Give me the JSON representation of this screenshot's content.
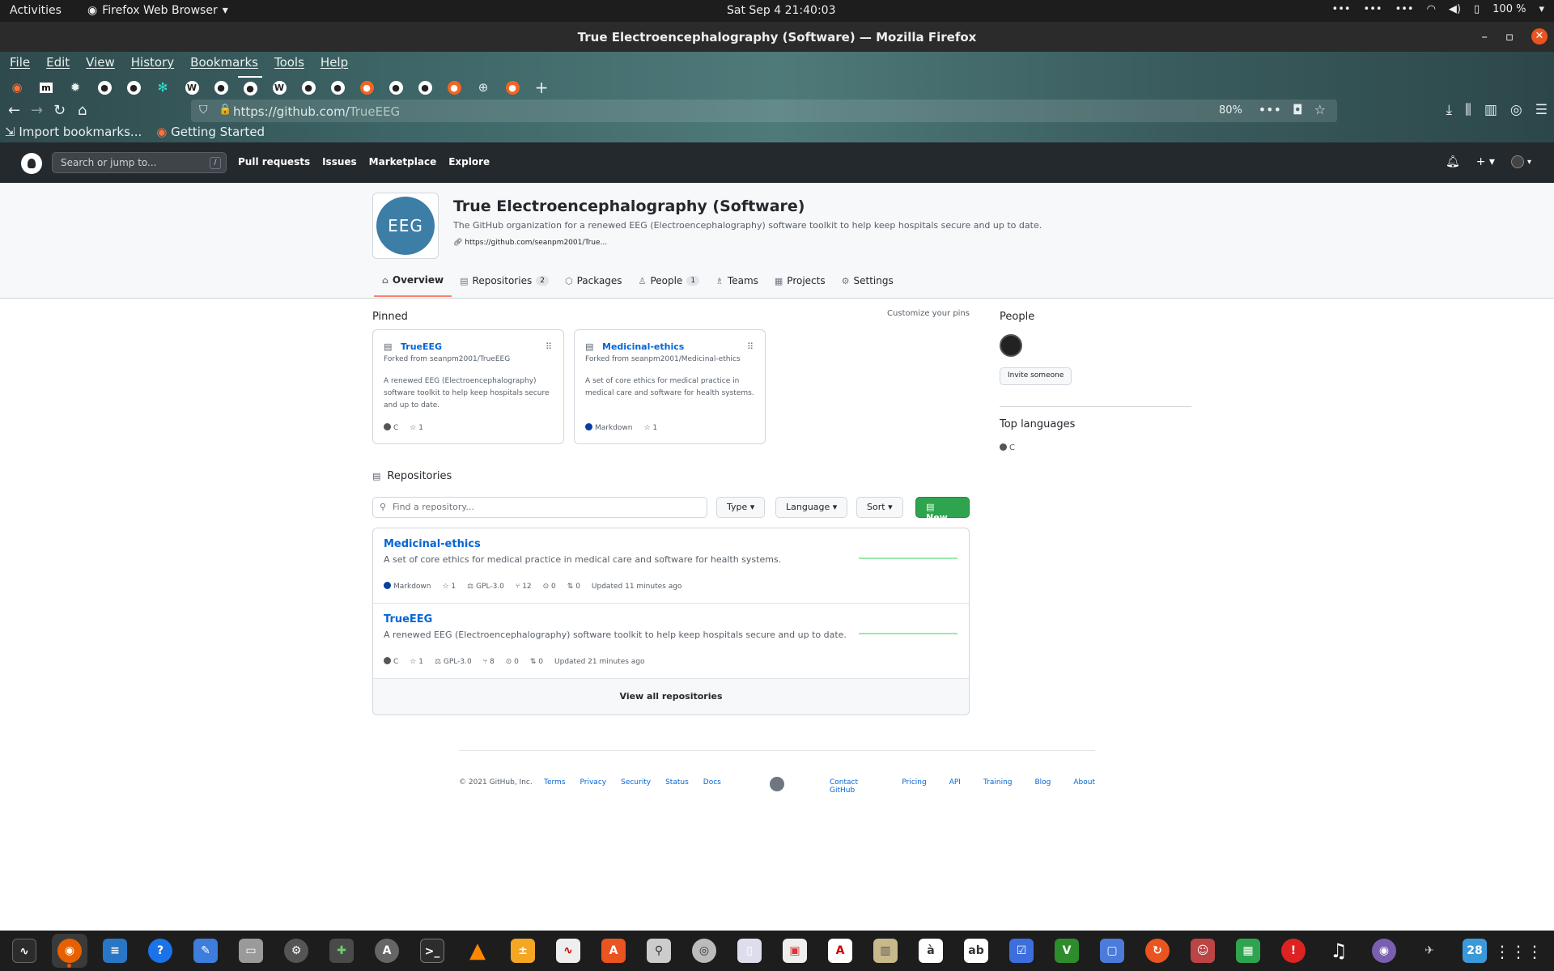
{
  "gnome": {
    "activities": "Activities",
    "app_menu": "Firefox Web Browser",
    "clock": "Sat Sep 4  21:40:03",
    "battery": "100 %"
  },
  "window": {
    "title": "True Electroencephalography (Software) — Mozilla Firefox"
  },
  "menubar": [
    "File",
    "Edit",
    "View",
    "History",
    "Bookmarks",
    "Tools",
    "Help"
  ],
  "browser": {
    "url_prefix": "https://github.com/",
    "url_path": "TrueEEG",
    "zoom": "80%",
    "bookmarks": [
      "Import bookmarks...",
      "Getting Started"
    ]
  },
  "github_header": {
    "search_placeholder": "Search or jump to...",
    "slash": "/",
    "nav": [
      "Pull requests",
      "Issues",
      "Marketplace",
      "Explore"
    ]
  },
  "org": {
    "avatar_text": "EEG",
    "name": "True Electroencephalography (Software)",
    "description": "The GitHub organization for a renewed EEG (Electroencephalography) software toolkit to help keep hospitals secure and up to date.",
    "link": "https://github.com/seanpm2001/True...",
    "tabs": [
      {
        "label": "Overview",
        "count": ""
      },
      {
        "label": "Repositories",
        "count": "2"
      },
      {
        "label": "Packages",
        "count": ""
      },
      {
        "label": "People",
        "count": "1"
      },
      {
        "label": "Teams",
        "count": ""
      },
      {
        "label": "Projects",
        "count": ""
      },
      {
        "label": "Settings",
        "count": ""
      }
    ]
  },
  "pinned": {
    "title": "Pinned",
    "customize": "Customize your pins",
    "items": [
      {
        "name": "TrueEEG",
        "fork": "Forked from seanpm2001/TrueEEG",
        "desc": "A renewed EEG (Electroencephalography) software toolkit to help keep hospitals secure and up to date.",
        "lang": "C",
        "lang_color": "#555555",
        "stars": "1"
      },
      {
        "name": "Medicinal-ethics",
        "fork": "Forked from seanpm2001/Medicinal-ethics",
        "desc": "A set of core ethics for medical practice in medical care and software for health systems.",
        "lang": "Markdown",
        "lang_color": "#083fa1",
        "stars": "1"
      }
    ]
  },
  "repositories": {
    "title": "Repositories",
    "find_placeholder": "Find a repository...",
    "type_btn": "Type",
    "language_btn": "Language",
    "sort_btn": "Sort",
    "new_btn": "New",
    "items": [
      {
        "name": "Medicinal-ethics",
        "desc": "A set of core ethics for medical practice in medical care and software for health systems.",
        "lang": "Markdown",
        "lang_color": "#083fa1",
        "stars": "1",
        "license": "GPL-3.0",
        "forks": "12",
        "issues": "0",
        "prs": "0",
        "updated": "Updated 11 minutes ago"
      },
      {
        "name": "TrueEEG",
        "desc": "A renewed EEG (Electroencephalography) software toolkit to help keep hospitals secure and up to date.",
        "lang": "C",
        "lang_color": "#555555",
        "stars": "1",
        "license": "GPL-3.0",
        "forks": "8",
        "issues": "0",
        "prs": "0",
        "updated": "Updated 21 minutes ago"
      }
    ],
    "view_all": "View all repositories"
  },
  "sidebar": {
    "people_title": "People",
    "invite": "Invite someone",
    "top_languages_title": "Top languages",
    "top_language": "C",
    "top_language_color": "#555555"
  },
  "footer": {
    "copyright": "© 2021 GitHub, Inc.",
    "left_links": [
      "Terms",
      "Privacy",
      "Security",
      "Status",
      "Docs"
    ],
    "right_links": [
      "Contact GitHub",
      "Pricing",
      "API",
      "Training",
      "Blog",
      "About"
    ]
  },
  "dock": {
    "calendar_day": "28"
  },
  "colors": {
    "accent_orange": "#e95420",
    "link_blue": "#0366d6",
    "new_green": "#2ea44f",
    "tab_underline": "#f9826c"
  }
}
